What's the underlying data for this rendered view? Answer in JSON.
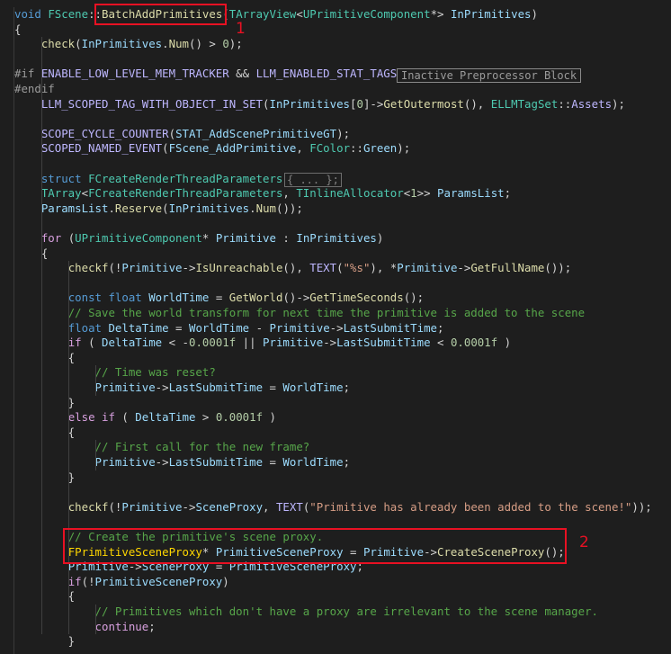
{
  "code_lines": [
    [
      [
        "kw",
        "void "
      ],
      [
        "type",
        "FScene"
      ],
      [
        "plain",
        "::"
      ],
      [
        "fn",
        "BatchAddPrimitives"
      ],
      [
        "plain",
        "("
      ],
      [
        "type",
        "TArrayView"
      ],
      [
        "plain",
        "<"
      ],
      [
        "type",
        "UPrimitiveComponent"
      ],
      [
        "plain",
        "*> "
      ],
      [
        "var",
        "InPrimitives"
      ],
      [
        "plain",
        ")"
      ]
    ],
    [
      [
        "plain",
        "{"
      ]
    ],
    [
      [
        "plain",
        "    "
      ],
      [
        "fn",
        "check"
      ],
      [
        "plain",
        "("
      ],
      [
        "var",
        "InPrimitives"
      ],
      [
        "plain",
        "."
      ],
      [
        "fn",
        "Num"
      ],
      [
        "plain",
        "() > "
      ],
      [
        "num",
        "0"
      ],
      [
        "plain",
        ");"
      ]
    ],
    [
      [
        "plain",
        ""
      ]
    ],
    [
      [
        "prepro",
        "#if "
      ],
      [
        "mac",
        "ENABLE_LOW_LEVEL_MEM_TRACKER"
      ],
      [
        "plain",
        " && "
      ],
      [
        "mac",
        "LLM_ENABLED_STAT_TAGS"
      ]
    ],
    [
      [
        "prepro",
        "#endif"
      ]
    ],
    [
      [
        "plain",
        "    "
      ],
      [
        "mac",
        "LLM_SCOPED_TAG_WITH_OBJECT_IN_SET"
      ],
      [
        "plain",
        "("
      ],
      [
        "var",
        "InPrimitives"
      ],
      [
        "plain",
        "["
      ],
      [
        "num",
        "0"
      ],
      [
        "plain",
        "]->"
      ],
      [
        "fn",
        "GetOutermost"
      ],
      [
        "plain",
        "(), "
      ],
      [
        "type",
        "ELLMTagSet"
      ],
      [
        "plain",
        "::"
      ],
      [
        "mac",
        "Assets"
      ],
      [
        "plain",
        ");"
      ]
    ],
    [
      [
        "plain",
        ""
      ]
    ],
    [
      [
        "plain",
        "    "
      ],
      [
        "mac",
        "SCOPE_CYCLE_COUNTER"
      ],
      [
        "plain",
        "("
      ],
      [
        "var",
        "STAT_AddScenePrimitiveGT"
      ],
      [
        "plain",
        ");"
      ]
    ],
    [
      [
        "plain",
        "    "
      ],
      [
        "mac",
        "SCOPED_NAMED_EVENT"
      ],
      [
        "plain",
        "("
      ],
      [
        "var",
        "FScene_AddPrimitive"
      ],
      [
        "plain",
        ", "
      ],
      [
        "type",
        "FColor"
      ],
      [
        "plain",
        "::"
      ],
      [
        "var",
        "Green"
      ],
      [
        "plain",
        ");"
      ]
    ],
    [
      [
        "plain",
        ""
      ]
    ],
    [
      [
        "plain",
        "    "
      ],
      [
        "kw",
        "struct "
      ],
      [
        "type",
        "FCreateRenderThreadParameters"
      ]
    ],
    [
      [
        "plain",
        "    "
      ],
      [
        "type",
        "TArray"
      ],
      [
        "plain",
        "<"
      ],
      [
        "type",
        "FCreateRenderThreadParameters"
      ],
      [
        "plain",
        ", "
      ],
      [
        "type",
        "TInlineAllocator"
      ],
      [
        "plain",
        "<"
      ],
      [
        "num",
        "1"
      ],
      [
        "plain",
        ">> "
      ],
      [
        "var",
        "ParamsList"
      ],
      [
        "plain",
        ";"
      ]
    ],
    [
      [
        "plain",
        "    "
      ],
      [
        "var",
        "ParamsList"
      ],
      [
        "plain",
        "."
      ],
      [
        "fn",
        "Reserve"
      ],
      [
        "plain",
        "("
      ],
      [
        "var",
        "InPrimitives"
      ],
      [
        "plain",
        "."
      ],
      [
        "fn",
        "Num"
      ],
      [
        "plain",
        "());"
      ]
    ],
    [
      [
        "plain",
        ""
      ]
    ],
    [
      [
        "plain",
        "    "
      ],
      [
        "ctl",
        "for "
      ],
      [
        "plain",
        "("
      ],
      [
        "type",
        "UPrimitiveComponent"
      ],
      [
        "plain",
        "* "
      ],
      [
        "var",
        "Primitive"
      ],
      [
        "plain",
        " : "
      ],
      [
        "var",
        "InPrimitives"
      ],
      [
        "plain",
        ")"
      ]
    ],
    [
      [
        "plain",
        "    {"
      ]
    ],
    [
      [
        "plain",
        "        "
      ],
      [
        "fn",
        "checkf"
      ],
      [
        "plain",
        "(!"
      ],
      [
        "var",
        "Primitive"
      ],
      [
        "plain",
        "->"
      ],
      [
        "fn",
        "IsUnreachable"
      ],
      [
        "plain",
        "(), "
      ],
      [
        "mac",
        "TEXT"
      ],
      [
        "plain",
        "("
      ],
      [
        "str",
        "\"%s\""
      ],
      [
        "plain",
        "), *"
      ],
      [
        "var",
        "Primitive"
      ],
      [
        "plain",
        "->"
      ],
      [
        "fn",
        "GetFullName"
      ],
      [
        "plain",
        "());"
      ]
    ],
    [
      [
        "plain",
        ""
      ]
    ],
    [
      [
        "plain",
        "        "
      ],
      [
        "kw",
        "const float "
      ],
      [
        "var",
        "WorldTime"
      ],
      [
        "plain",
        " = "
      ],
      [
        "fn",
        "GetWorld"
      ],
      [
        "plain",
        "()->"
      ],
      [
        "fn",
        "GetTimeSeconds"
      ],
      [
        "plain",
        "();"
      ]
    ],
    [
      [
        "plain",
        "        "
      ],
      [
        "cmt",
        "// Save the world transform for next time the primitive is added to the scene"
      ]
    ],
    [
      [
        "plain",
        "        "
      ],
      [
        "kw",
        "float "
      ],
      [
        "var",
        "DeltaTime"
      ],
      [
        "plain",
        " = "
      ],
      [
        "var",
        "WorldTime"
      ],
      [
        "plain",
        " - "
      ],
      [
        "var",
        "Primitive"
      ],
      [
        "plain",
        "->"
      ],
      [
        "var",
        "LastSubmitTime"
      ],
      [
        "plain",
        ";"
      ]
    ],
    [
      [
        "plain",
        "        "
      ],
      [
        "ctl",
        "if "
      ],
      [
        "plain",
        "( "
      ],
      [
        "var",
        "DeltaTime"
      ],
      [
        "plain",
        " < -"
      ],
      [
        "num",
        "0.0001f"
      ],
      [
        "plain",
        " || "
      ],
      [
        "var",
        "Primitive"
      ],
      [
        "plain",
        "->"
      ],
      [
        "var",
        "LastSubmitTime"
      ],
      [
        "plain",
        " < "
      ],
      [
        "num",
        "0.0001f"
      ],
      [
        "plain",
        " )"
      ]
    ],
    [
      [
        "plain",
        "        {"
      ]
    ],
    [
      [
        "plain",
        "            "
      ],
      [
        "cmt",
        "// Time was reset?"
      ]
    ],
    [
      [
        "plain",
        "            "
      ],
      [
        "var",
        "Primitive"
      ],
      [
        "plain",
        "->"
      ],
      [
        "var",
        "LastSubmitTime"
      ],
      [
        "plain",
        " = "
      ],
      [
        "var",
        "WorldTime"
      ],
      [
        "plain",
        ";"
      ]
    ],
    [
      [
        "plain",
        "        }"
      ]
    ],
    [
      [
        "plain",
        "        "
      ],
      [
        "ctl",
        "else if "
      ],
      [
        "plain",
        "( "
      ],
      [
        "var",
        "DeltaTime"
      ],
      [
        "plain",
        " > "
      ],
      [
        "num",
        "0.0001f"
      ],
      [
        "plain",
        " )"
      ]
    ],
    [
      [
        "plain",
        "        {"
      ]
    ],
    [
      [
        "plain",
        "            "
      ],
      [
        "cmt",
        "// First call for the new frame?"
      ]
    ],
    [
      [
        "plain",
        "            "
      ],
      [
        "var",
        "Primitive"
      ],
      [
        "plain",
        "->"
      ],
      [
        "var",
        "LastSubmitTime"
      ],
      [
        "plain",
        " = "
      ],
      [
        "var",
        "WorldTime"
      ],
      [
        "plain",
        ";"
      ]
    ],
    [
      [
        "plain",
        "        }"
      ]
    ],
    [
      [
        "plain",
        ""
      ]
    ],
    [
      [
        "plain",
        "        "
      ],
      [
        "fn",
        "checkf"
      ],
      [
        "plain",
        "(!"
      ],
      [
        "var",
        "Primitive"
      ],
      [
        "plain",
        "->"
      ],
      [
        "var",
        "SceneProxy"
      ],
      [
        "plain",
        ", "
      ],
      [
        "mac",
        "TEXT"
      ],
      [
        "plain",
        "("
      ],
      [
        "str",
        "\"Primitive has already been added to the scene!\""
      ],
      [
        "plain",
        "));"
      ]
    ],
    [
      [
        "plain",
        ""
      ]
    ],
    [
      [
        "plain",
        "        "
      ],
      [
        "cmt",
        "// Create the primitive's scene proxy."
      ]
    ],
    [
      [
        "plain",
        "        "
      ],
      [
        "gold",
        "FPrimitiveSceneProxy"
      ],
      [
        "plain",
        "* "
      ],
      [
        "var",
        "PrimitiveSceneProxy"
      ],
      [
        "plain",
        " = "
      ],
      [
        "var",
        "Primitive"
      ],
      [
        "plain",
        "->"
      ],
      [
        "fn",
        "CreateSceneProxy"
      ],
      [
        "plain",
        "();"
      ]
    ],
    [
      [
        "plain",
        "        "
      ],
      [
        "var",
        "Primitive"
      ],
      [
        "plain",
        "->"
      ],
      [
        "var",
        "SceneProxy"
      ],
      [
        "plain",
        " = "
      ],
      [
        "var",
        "PrimitiveSceneProxy"
      ],
      [
        "plain",
        ";"
      ]
    ],
    [
      [
        "plain",
        "        "
      ],
      [
        "ctl",
        "if"
      ],
      [
        "plain",
        "(!"
      ],
      [
        "var",
        "PrimitiveSceneProxy"
      ],
      [
        "plain",
        ")"
      ]
    ],
    [
      [
        "plain",
        "        {"
      ]
    ],
    [
      [
        "plain",
        "            "
      ],
      [
        "cmt",
        "// Primitives which don't have a proxy are irrelevant to the scene manager."
      ]
    ],
    [
      [
        "plain",
        "            "
      ],
      [
        "ctl",
        "continue"
      ],
      [
        "plain",
        ";"
      ]
    ],
    [
      [
        "plain",
        "        }"
      ]
    ]
  ],
  "inactive_block_label": "Inactive Preprocessor Block",
  "collapsed_struct_label": "{ ... };",
  "annotations": [
    "1",
    "2"
  ],
  "colors": {
    "background": "#1e1e1e",
    "annotation_red": "#e81123"
  }
}
